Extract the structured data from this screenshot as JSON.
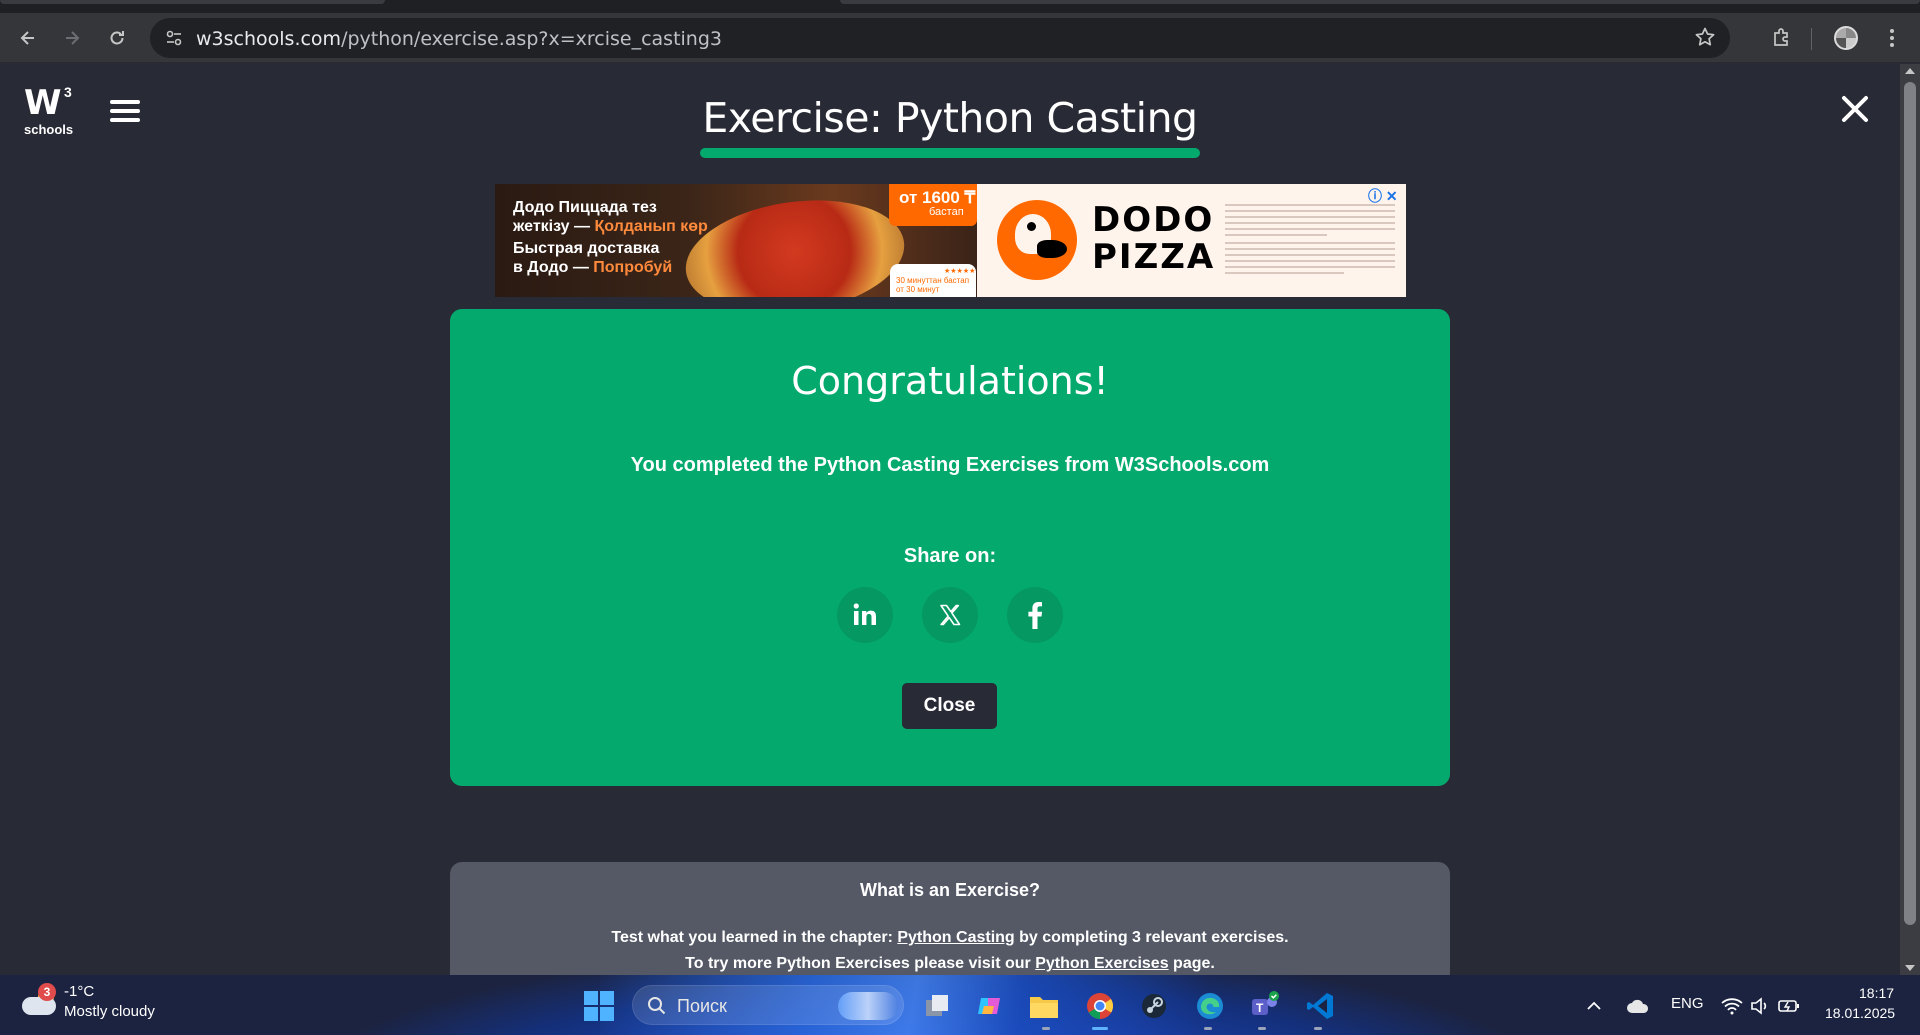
{
  "browser": {
    "url_host": "w3schools.com",
    "url_path": "/python/exercise.asp?x=xrcise_casting3"
  },
  "page": {
    "logo_w": "W",
    "logo_sup": "3",
    "logo_sub": "schools",
    "title": "Exercise: Python Casting",
    "accent_color": "#04aa6d",
    "background_color": "#282a35"
  },
  "ad": {
    "line1a": "Додо Пиццада тез",
    "line1b": "жеткізу — ",
    "line1c": "Қолданып көр",
    "line2a": "Быстрая доставка",
    "line2b": "в Додо — ",
    "line2c": "Попробуй",
    "price": "от 1600 ₸",
    "price_sub": "бастап",
    "promo_small": "30 минуттан бастап от 30 минут",
    "brand_line1": "DODO",
    "brand_line2": "PIZZA",
    "icon_adchoices": "info-icon",
    "icon_close": "close-icon"
  },
  "congrats": {
    "heading": "Congratulations!",
    "message": "You completed the Python Casting Exercises from W3Schools.com",
    "share_label": "Share on:",
    "share_buttons": [
      {
        "name": "linkedin",
        "icon": "in"
      },
      {
        "name": "x",
        "icon": "X"
      },
      {
        "name": "facebook",
        "icon": "f"
      }
    ],
    "close_label": "Close"
  },
  "info": {
    "title": "What is an Exercise?",
    "line1_prefix": "Test what you learned in the chapter: ",
    "line1_link": "Python Casting",
    "line1_suffix": " by completing 3 relevant exercises.",
    "line2_prefix": "To try more Python Exercises please visit our ",
    "line2_link": "Python Exercises",
    "line2_suffix": " page."
  },
  "taskbar": {
    "weather_badge": "3",
    "temperature": "-1°C",
    "condition": "Mostly cloudy",
    "search_label": "Поиск",
    "language": "ENG",
    "time": "18:17",
    "date": "18.01.2025"
  }
}
